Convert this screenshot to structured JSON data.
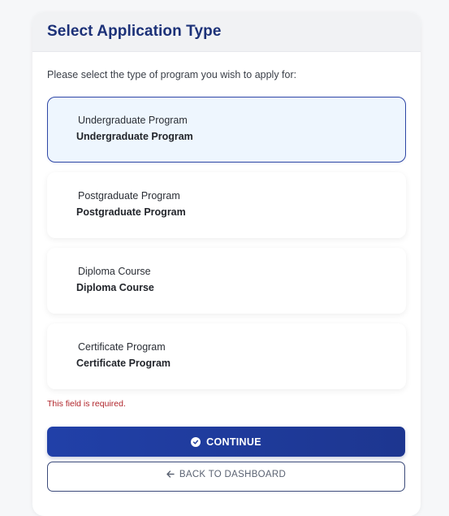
{
  "header": {
    "title": "Select Application Type"
  },
  "instructions": "Please select the type of program you wish to apply for:",
  "options": [
    {
      "title": "Undergraduate Program",
      "subtitle": "Undergraduate Program",
      "selected": true
    },
    {
      "title": "Postgraduate Program",
      "subtitle": "Postgraduate Program",
      "selected": false
    },
    {
      "title": "Diploma Course",
      "subtitle": "Diploma Course",
      "selected": false
    },
    {
      "title": "Certificate Program",
      "subtitle": "Certificate Program",
      "selected": false
    }
  ],
  "error": "This field is required.",
  "buttons": {
    "continue_label": "CONTINUE",
    "back_label": "BACK TO DASHBOARD"
  },
  "icons": {
    "continue": "check-circle-icon",
    "back": "arrow-left-icon"
  },
  "colors": {
    "primary": "#1e3a9a",
    "title": "#1c3178",
    "error": "#b0242a",
    "selected_bg": "#eef6fe",
    "selected_border": "#2f47a6"
  }
}
